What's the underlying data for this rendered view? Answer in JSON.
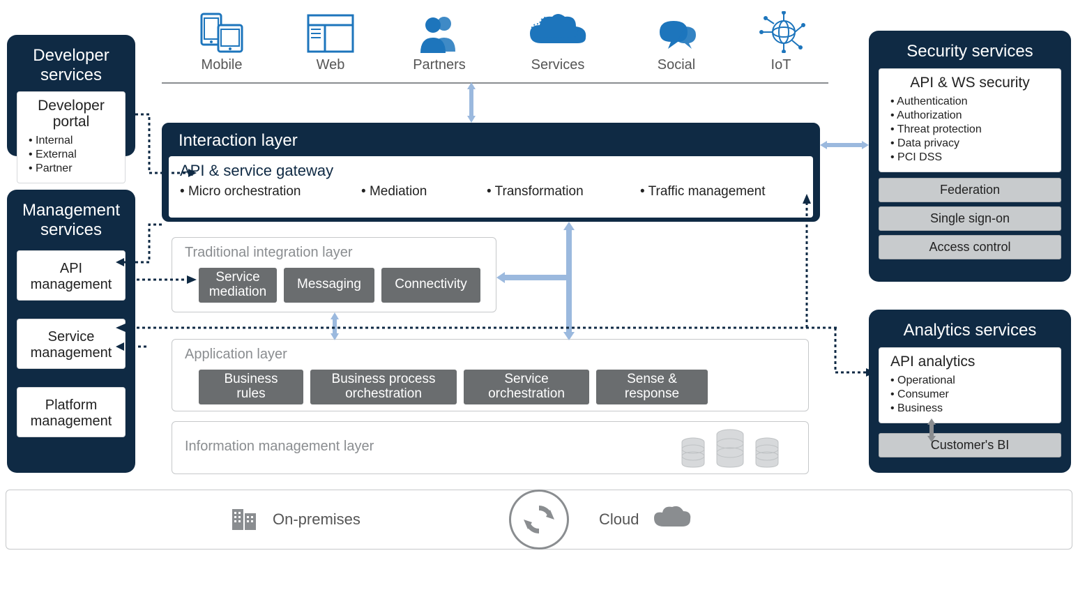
{
  "colors": {
    "navy": "#0f2a44",
    "blue": "#1d75bc",
    "lightblue": "#9bb9de",
    "grey": "#8a8d90",
    "chip": "#6a6d6f",
    "pill": "#c8cbcd"
  },
  "developer_services": {
    "title": "Developer services",
    "portal_title": "Developer portal",
    "portal_items": [
      "Internal",
      "External",
      "Partner"
    ]
  },
  "management_services": {
    "title": "Management services",
    "items": [
      "API management",
      "Service management",
      "Platform management"
    ]
  },
  "security_services": {
    "title": "Security services",
    "card_title": "API & WS security",
    "card_items": [
      "Authentication",
      "Authorization",
      "Threat protection",
      "Data privacy",
      "PCI DSS"
    ],
    "pills": [
      "Federation",
      "Single sign-on",
      "Access control"
    ]
  },
  "analytics_services": {
    "title": "Analytics services",
    "card_title": "API analytics",
    "card_items": [
      "Operational",
      "Consumer",
      "Business"
    ],
    "pill": "Customer's BI"
  },
  "channels": [
    {
      "name": "mobile-icon",
      "label": "Mobile"
    },
    {
      "name": "web-icon",
      "label": "Web"
    },
    {
      "name": "partners-icon",
      "label": "Partners"
    },
    {
      "name": "services-icon",
      "label": "Services"
    },
    {
      "name": "social-icon",
      "label": "Social"
    },
    {
      "name": "iot-icon",
      "label": "IoT"
    }
  ],
  "interaction_layer": {
    "title": "Interaction layer",
    "gateway_title": "API & service gateway",
    "gateway_items": [
      "Micro orchestration",
      "Mediation",
      "Transformation",
      "Traffic management"
    ]
  },
  "traditional_layer": {
    "title": "Traditional integration layer",
    "chips": [
      "Service mediation",
      "Messaging",
      "Connectivity"
    ]
  },
  "application_layer": {
    "title": "Application layer",
    "chips": [
      "Business rules",
      "Business process orchestration",
      "Service orchestration",
      "Sense & response"
    ]
  },
  "info_layer_title": "Information management layer",
  "deployment": {
    "on_prem": "On-premises",
    "cloud": "Cloud"
  }
}
